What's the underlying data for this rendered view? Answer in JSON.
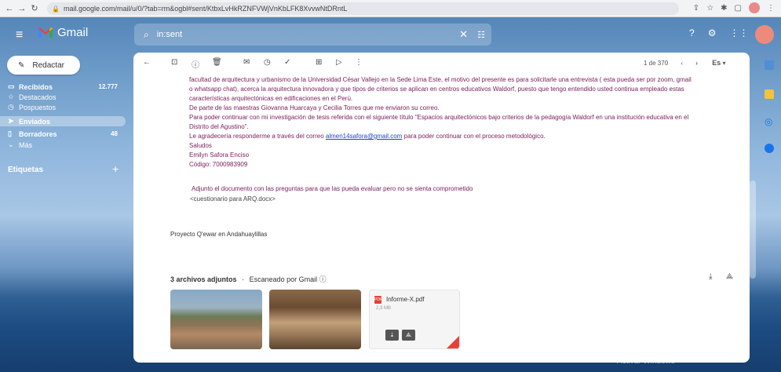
{
  "browser": {
    "url": "mail.google.com/mail/u/0/?tab=rm&ogbl#sent/KtbxLvHkRZNFVWjVnKbLFK8XvvwNtDRntL"
  },
  "header": {
    "app_name": "Gmail",
    "search_value": "in:sent"
  },
  "sidebar": {
    "compose_label": "Redactar",
    "items": [
      {
        "label": "Recibidos",
        "count": "12.777"
      },
      {
        "label": "Destacados",
        "count": ""
      },
      {
        "label": "Pospuestos",
        "count": ""
      },
      {
        "label": "Enviados",
        "count": ""
      },
      {
        "label": "Borradores",
        "count": "48"
      },
      {
        "label": "Más",
        "count": ""
      }
    ],
    "labels_heading": "Etiquetas"
  },
  "toolbar": {
    "pager": "1 de 370",
    "lang": "Es"
  },
  "email": {
    "lines": [
      "facultad de arquitectura y urbanismo de la Universidad César Vallejo en la Sede Lima Este, el motivo del presente es para solicitarle una entrevista ( esta pueda ser por zoom, gmail",
      "o whatsapp chat), acerca la arquitectura innovadora y que tipos de criterios se aplican en centros educativos Waldorf, puesto que tengo entendido usted continua empleado estas",
      "características arquitectónicas en edificaciones en el Perú.",
      "De parte de las maestras Giovanna Huarcaya y Cecilia Torres que me enviaron su correo.",
      "Para poder continuar con mi investigación de tesis referida con el siguiente título \"Espacios arquitectónicos bajo criterios de la pedagogía Waldorf en una institución educativa en el",
      "Distrito del Agustino\"."
    ],
    "reply_prefix": "Le agradecería responderme a través del correo",
    "reply_email": "almen14safora@gmail.com",
    "reply_suffix": "para poder continuar con el proceso metodológico.",
    "closing": "Saludos",
    "signature_name": "Emilyn Safora Enciso",
    "signature_code": "Código: 7000983909",
    "attach_note": "Adjunto el documento con las preguntas para que las pueda evaluar pero no se sienta comprometido",
    "attach_file": "<cuestionario para ARQ.docx>",
    "project": "Proyecto Q'ewar en Andahuaylillas"
  },
  "attachments": {
    "heading": "3 archivos adjuntos",
    "scanned": "Escaneado por Gmail",
    "pdf_name": "Informe-X.pdf",
    "pdf_size": "2,3 MB"
  },
  "watermark": "Activar Windows"
}
